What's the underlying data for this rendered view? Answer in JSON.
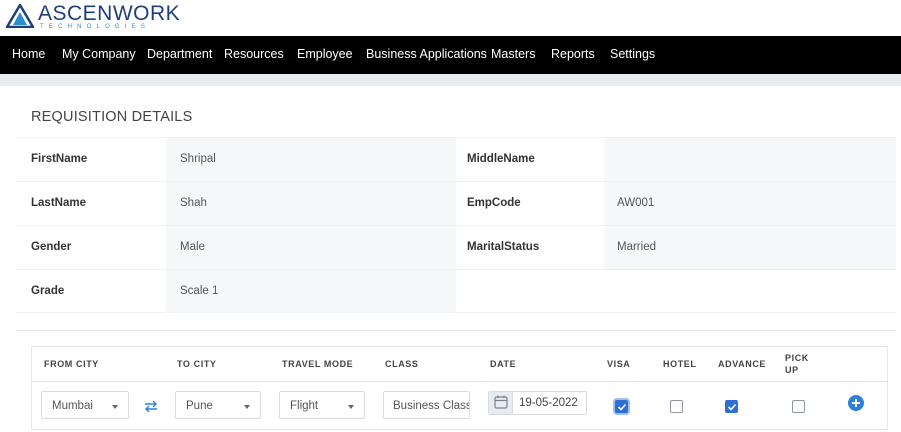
{
  "brand": {
    "name": "ASCENWORK",
    "tagline": "TECHNOLOGIES"
  },
  "nav": [
    "Home",
    "My Company",
    "Department",
    "Resources",
    "Employee",
    "Business Applications",
    "Masters",
    "Reports",
    "Settings"
  ],
  "section_title": "REQUISITION DETAILS",
  "details": [
    {
      "label": "FirstName",
      "value": "Shripal",
      "label2": "MiddleName",
      "value2": ""
    },
    {
      "label": "LastName",
      "value": "Shah",
      "label2": "EmpCode",
      "value2": "AW001"
    },
    {
      "label": "Gender",
      "value": "Male",
      "label2": "MaritalStatus",
      "value2": "Married"
    },
    {
      "label": "Grade",
      "value": "Scale 1"
    }
  ],
  "travel": {
    "headers": {
      "from_city": "FROM CITY",
      "to_city": "TO CITY",
      "travel_mode": "TRAVEL MODE",
      "class": "CLASS",
      "date": "DATE",
      "visa": "VISA",
      "hotel": "HOTEL",
      "advance": "ADVANCE",
      "pickup_line1": "PICK",
      "pickup_line2": "UP"
    },
    "row": {
      "from_city": "Mumbai",
      "to_city": "Pune",
      "travel_mode": "Flight",
      "class": "Business Class",
      "date": "19-05-2022",
      "visa": true,
      "hotel": false,
      "advance": true,
      "pickup": false
    }
  },
  "icons": {
    "swap": "swap-arrows-icon",
    "calendar": "calendar-icon",
    "add": "plus-circle-icon",
    "check": "check-icon"
  },
  "colors": {
    "navbar": "#000000",
    "accent": "#2f6fd3",
    "brand": "#1f3f7a",
    "add_icon": "#2f80d8"
  }
}
